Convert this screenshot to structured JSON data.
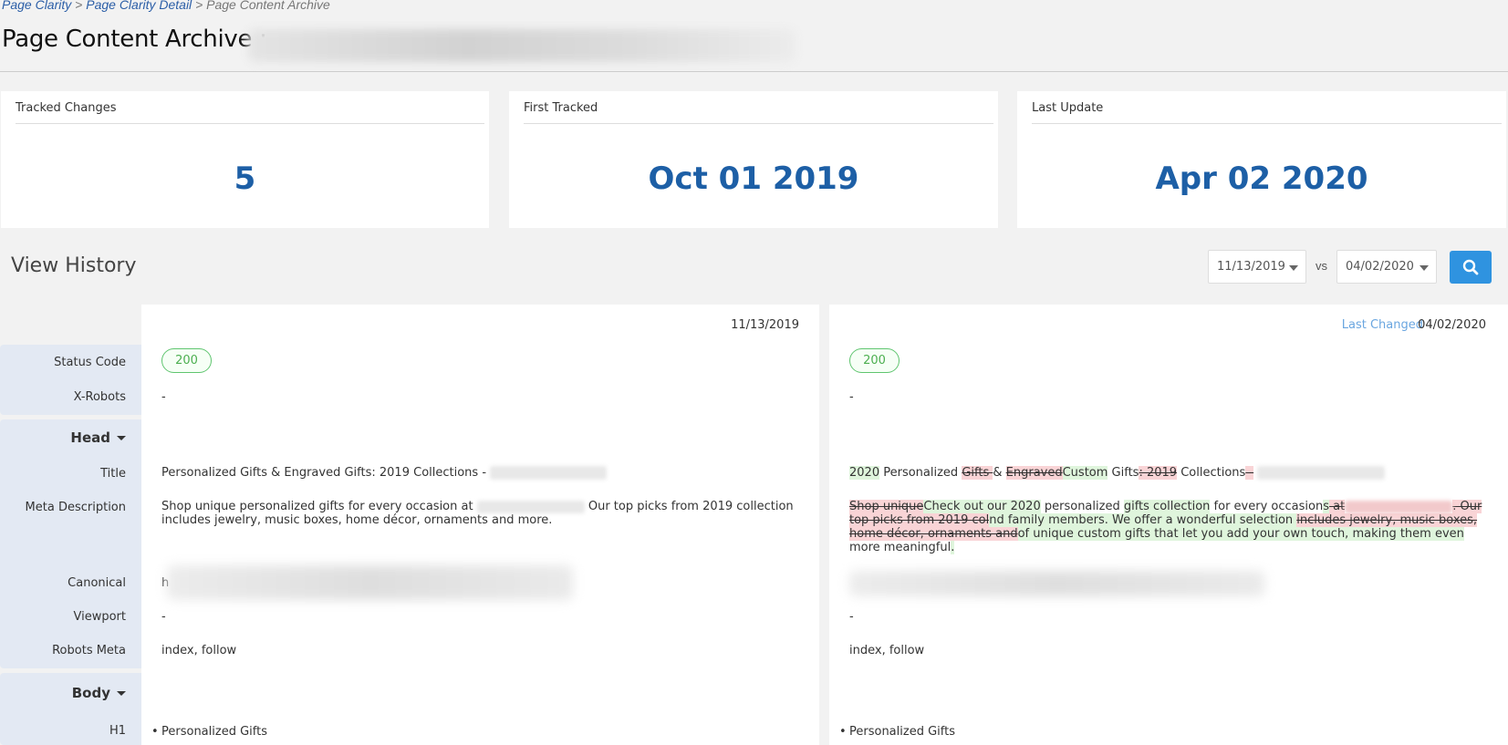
{
  "breadcrumb": {
    "item1": "Page Clarity",
    "item2": "Page Clarity Detail",
    "item3": "Page Content Archive",
    "sep": ">"
  },
  "page_title": "Page Content Archive :",
  "stats": {
    "tracked_changes_label": "Tracked Changes",
    "tracked_changes_value": "5",
    "first_tracked_label": "First Tracked",
    "first_tracked_value": "Oct 01 2019",
    "last_update_label": "Last Update",
    "last_update_value": "Apr 02 2020"
  },
  "view_history": {
    "title": "View History",
    "date_from": "11/13/2019",
    "vs_label": "vs",
    "date_to": "04/02/2020"
  },
  "labels": {
    "status_code": "Status Code",
    "x_robots": "X-Robots",
    "head": "Head",
    "title": "Title",
    "meta_description": "Meta Description",
    "canonical": "Canonical",
    "viewport": "Viewport",
    "robots_meta": "Robots Meta",
    "body": "Body",
    "h1": "H1"
  },
  "left_panel": {
    "date": "11/13/2019",
    "status_code": "200",
    "x_robots": "-",
    "title": "Personalized Gifts & Engraved Gifts: 2019 Collections -",
    "meta_desc_part1": "Shop unique personalized gifts for every occasion at",
    "meta_desc_part2": "Our top picks from 2019 collection",
    "meta_desc_part3": "includes jewelry, music boxes, home décor, ornaments and more.",
    "canonical_prefix": "h",
    "viewport": "-",
    "robots_meta": "index, follow",
    "h1_bullet": "•",
    "h1": "Personalized Gifts"
  },
  "right_panel": {
    "last_changed_label": "Last Changed",
    "date": "04/02/2020",
    "status_code": "200",
    "x_robots": "-",
    "title_segments": {
      "s1": "2020",
      "s2": " Personalized ",
      "s3": "Gifts ",
      "s4": "& ",
      "s5": "Engraved",
      "s6": "Custom",
      "s7": " Gifts",
      "s8": ": 2019",
      "s9": " Collections",
      "s10": " -"
    },
    "meta_segments": {
      "s1": "Shop unique",
      "s2": "Check out our 2020",
      "s3": " personalized ",
      "s4": "gifts collection",
      "s5": " for every occasion",
      "s6": "s",
      "s7": " at",
      "s8": ". Our top picks from 2019 col",
      "s9": "nd family members. We offer a wonderful selection ",
      "s10": "includes jewelry, music boxes, home décor, ornaments and",
      "s11": "of unique custom gifts that let you add your own touch, making them even",
      "s12": " more meaningful",
      "s13": "."
    },
    "viewport": "-",
    "robots_meta": "index, follow",
    "h1_bullet": "•",
    "h1": "Personalized Gifts"
  },
  "icons": {
    "search": "search-icon",
    "caret": "caret-down-icon"
  },
  "colors": {
    "accent": "#1d5fa6",
    "button": "#2f93e0",
    "added": "#dff5dc",
    "removed": "#f9d4d6",
    "status_ok": "#4caf50"
  }
}
